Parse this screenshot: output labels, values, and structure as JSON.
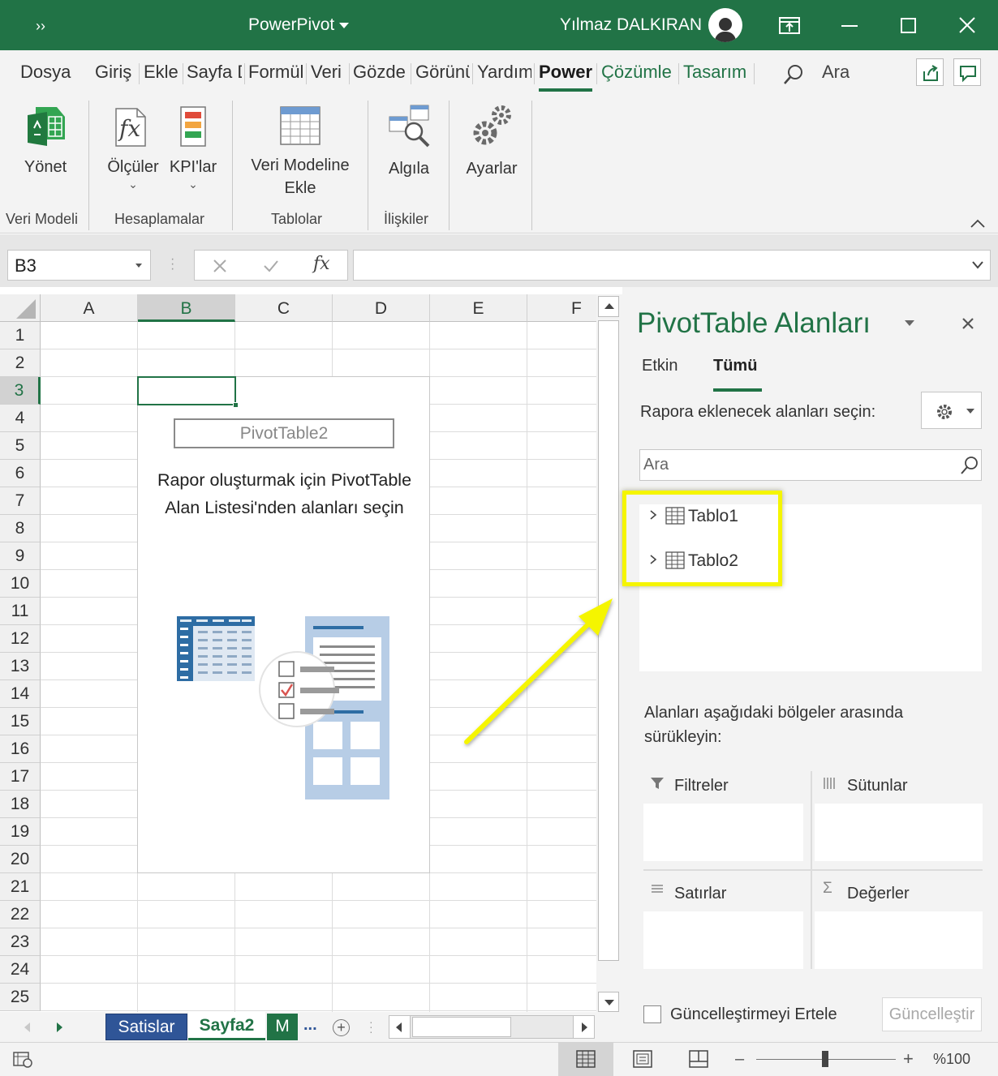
{
  "window": {
    "title": "PowerPivot",
    "quick_access": "››",
    "user": "Yılmaz DALKIRAN"
  },
  "ribbon_tabs": [
    "Dosya",
    "Giriş",
    "Ekle",
    "Sayfa D",
    "Formül",
    "Veri",
    "Gözden",
    "Görünüm",
    "Yardım",
    "Power",
    "Çözümle",
    "Tasarım"
  ],
  "active_tab": "Power",
  "tell_me": "Ara",
  "ribbon": {
    "buttons": {
      "manage": "Yönet",
      "measures": "Ölçüler",
      "kpis": "KPI'lar",
      "add_model_1": "Veri Modeline",
      "add_model_2": "Ekle",
      "detect": "Algıla",
      "settings": "Ayarlar"
    },
    "groups": {
      "data_model": "Veri Modeli",
      "calculations": "Hesaplamalar",
      "tables": "Tablolar",
      "relationships": "İlişkiler"
    }
  },
  "formula_bar": {
    "name_box": "B3",
    "formula": ""
  },
  "sheet": {
    "columns": [
      "A",
      "B",
      "C",
      "D",
      "E",
      "F"
    ],
    "rows": [
      "1",
      "2",
      "3",
      "4",
      "5",
      "6",
      "7",
      "8",
      "9",
      "10",
      "11",
      "12",
      "13",
      "14",
      "15",
      "16",
      "17",
      "18",
      "19",
      "20",
      "21",
      "22",
      "23",
      "24",
      "25"
    ],
    "active_cell": "B3",
    "pivot_name": "PivotTable2",
    "pivot_msg_1": "Rapor oluşturmak için PivotTable",
    "pivot_msg_2": "Alan Listesi'nden alanları seçin"
  },
  "sheet_tabs": [
    "Satislar",
    "Sayfa2",
    "M"
  ],
  "sheet_tabs_more": "...",
  "pane": {
    "title": "PivotTable Alanları",
    "tab_active": "Etkin",
    "tab_all": "Tümü",
    "choose_label": "Rapora eklenecek alanları seçin:",
    "search_placeholder": "Ara",
    "tables": [
      "Tablo1",
      "Tablo2"
    ],
    "drag_label_1": "Alanları aşağıdaki bölgeler arasında",
    "drag_label_2": "sürükleyin:",
    "areas": {
      "filters": "Filtreler",
      "columns": "Sütunlar",
      "rows": "Satırlar",
      "values": "Değerler"
    },
    "defer_label": "Güncelleştirmeyi Ertele",
    "update_button": "Güncelleştir"
  },
  "status": {
    "zoom": "%100"
  },
  "colors": {
    "excel_green": "#217346",
    "highlight": "#f5f500",
    "pivot_illustration_blue": "#2e6da4"
  }
}
